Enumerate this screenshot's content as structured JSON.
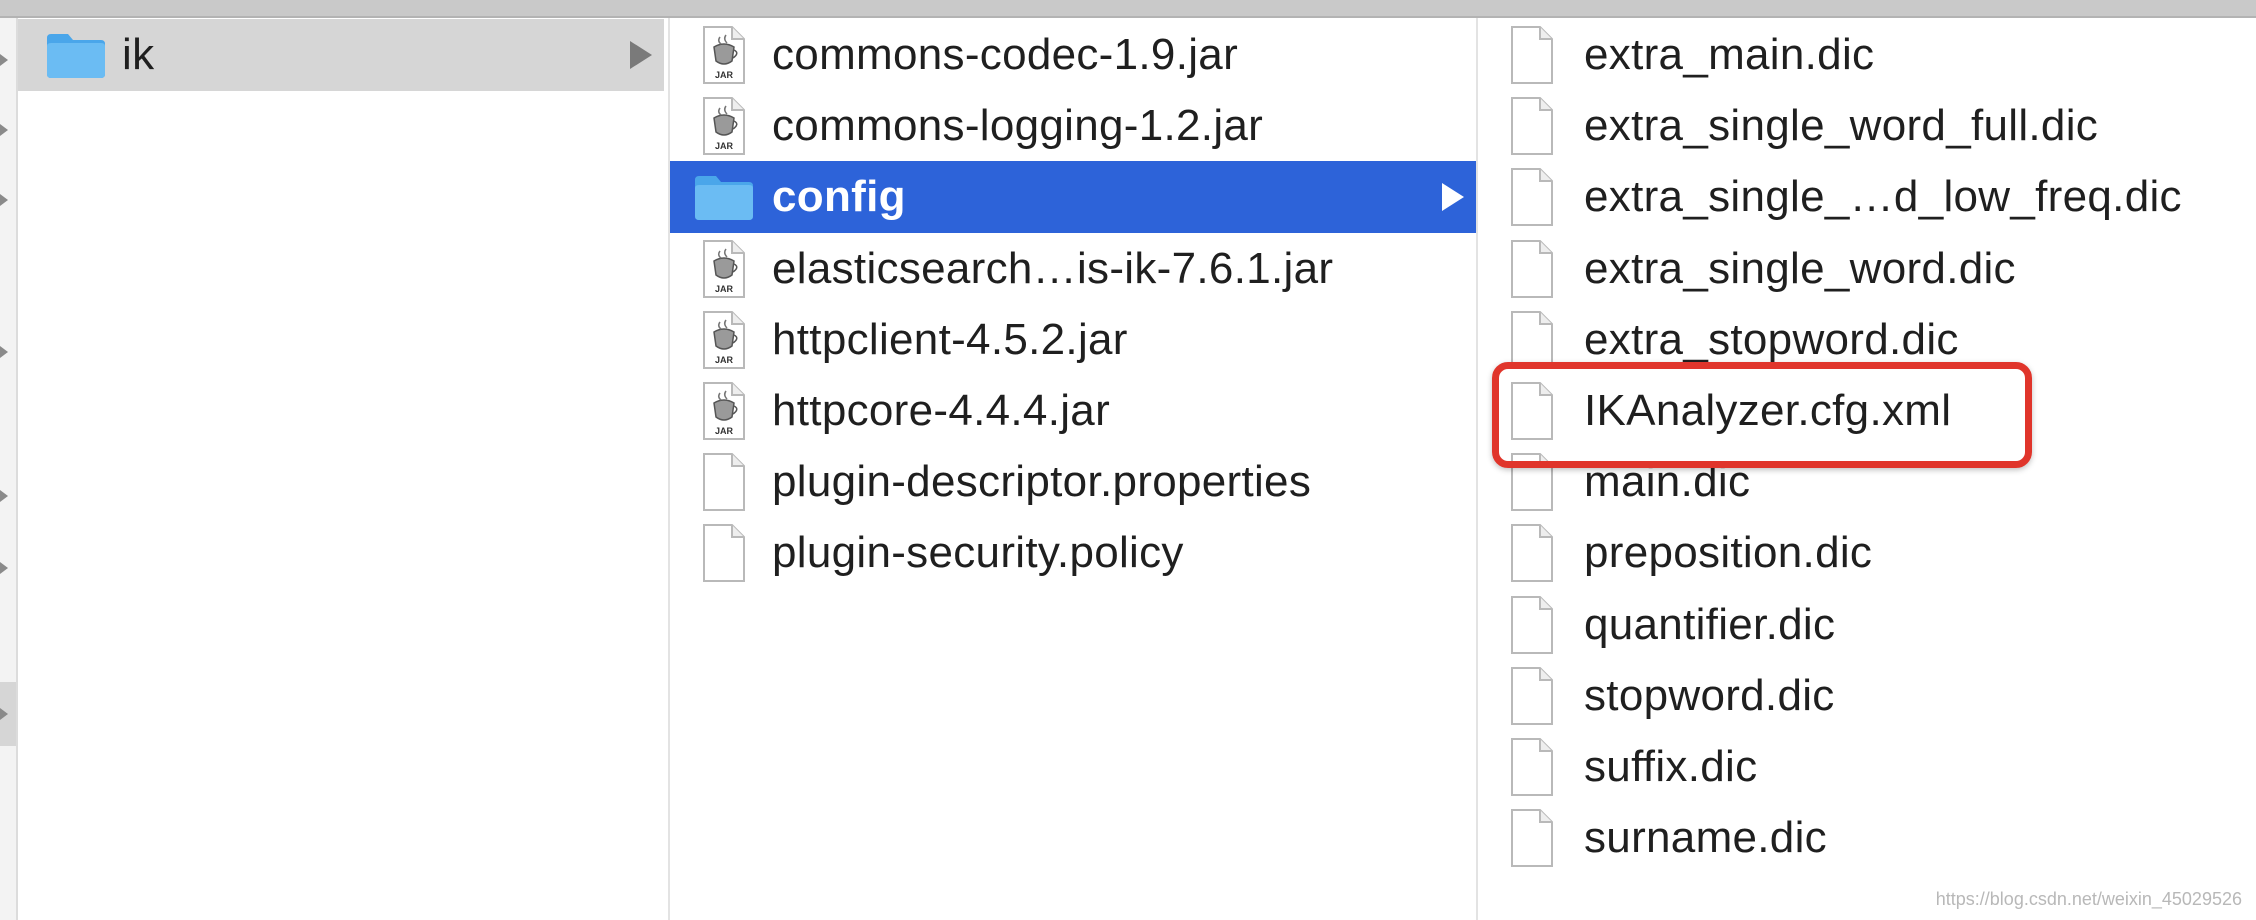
{
  "colors": {
    "selection_blue": "#2d63d9",
    "selection_gray": "#d6d6d6",
    "folder_blue": "#6bbcf3",
    "highlight_red": "#e0352b"
  },
  "column1": {
    "items": [
      {
        "label": "ik",
        "icon": "folder-icon",
        "selected": "gray",
        "has_children": true
      }
    ]
  },
  "column2": {
    "items": [
      {
        "label": "commons-codec-1.9.jar",
        "icon": "jar-icon"
      },
      {
        "label": "commons-logging-1.2.jar",
        "icon": "jar-icon"
      },
      {
        "label": "config",
        "icon": "folder-icon",
        "selected": "blue",
        "has_children": true
      },
      {
        "label": "elasticsearch…is-ik-7.6.1.jar",
        "icon": "jar-icon"
      },
      {
        "label": "httpclient-4.5.2.jar",
        "icon": "jar-icon"
      },
      {
        "label": "httpcore-4.4.4.jar",
        "icon": "jar-icon"
      },
      {
        "label": "plugin-descriptor.properties",
        "icon": "document-icon"
      },
      {
        "label": "plugin-security.policy",
        "icon": "document-icon"
      }
    ],
    "jar_badge": "JAR"
  },
  "column3": {
    "items": [
      {
        "label": "extra_main.dic",
        "icon": "document-icon"
      },
      {
        "label": "extra_single_word_full.dic",
        "icon": "document-icon"
      },
      {
        "label": "extra_single_…d_low_freq.dic",
        "icon": "document-icon"
      },
      {
        "label": "extra_single_word.dic",
        "icon": "document-icon"
      },
      {
        "label": "extra_stopword.dic",
        "icon": "document-icon"
      },
      {
        "label": "IKAnalyzer.cfg.xml",
        "icon": "document-icon",
        "highlighted": true
      },
      {
        "label": "main.dic",
        "icon": "document-icon"
      },
      {
        "label": "preposition.dic",
        "icon": "document-icon"
      },
      {
        "label": "quantifier.dic",
        "icon": "document-icon"
      },
      {
        "label": "stopword.dic",
        "icon": "document-icon"
      },
      {
        "label": "suffix.dic",
        "icon": "document-icon"
      },
      {
        "label": "surname.dic",
        "icon": "document-icon"
      }
    ]
  },
  "watermark": "https://blog.csdn.net/weixin_45029526"
}
